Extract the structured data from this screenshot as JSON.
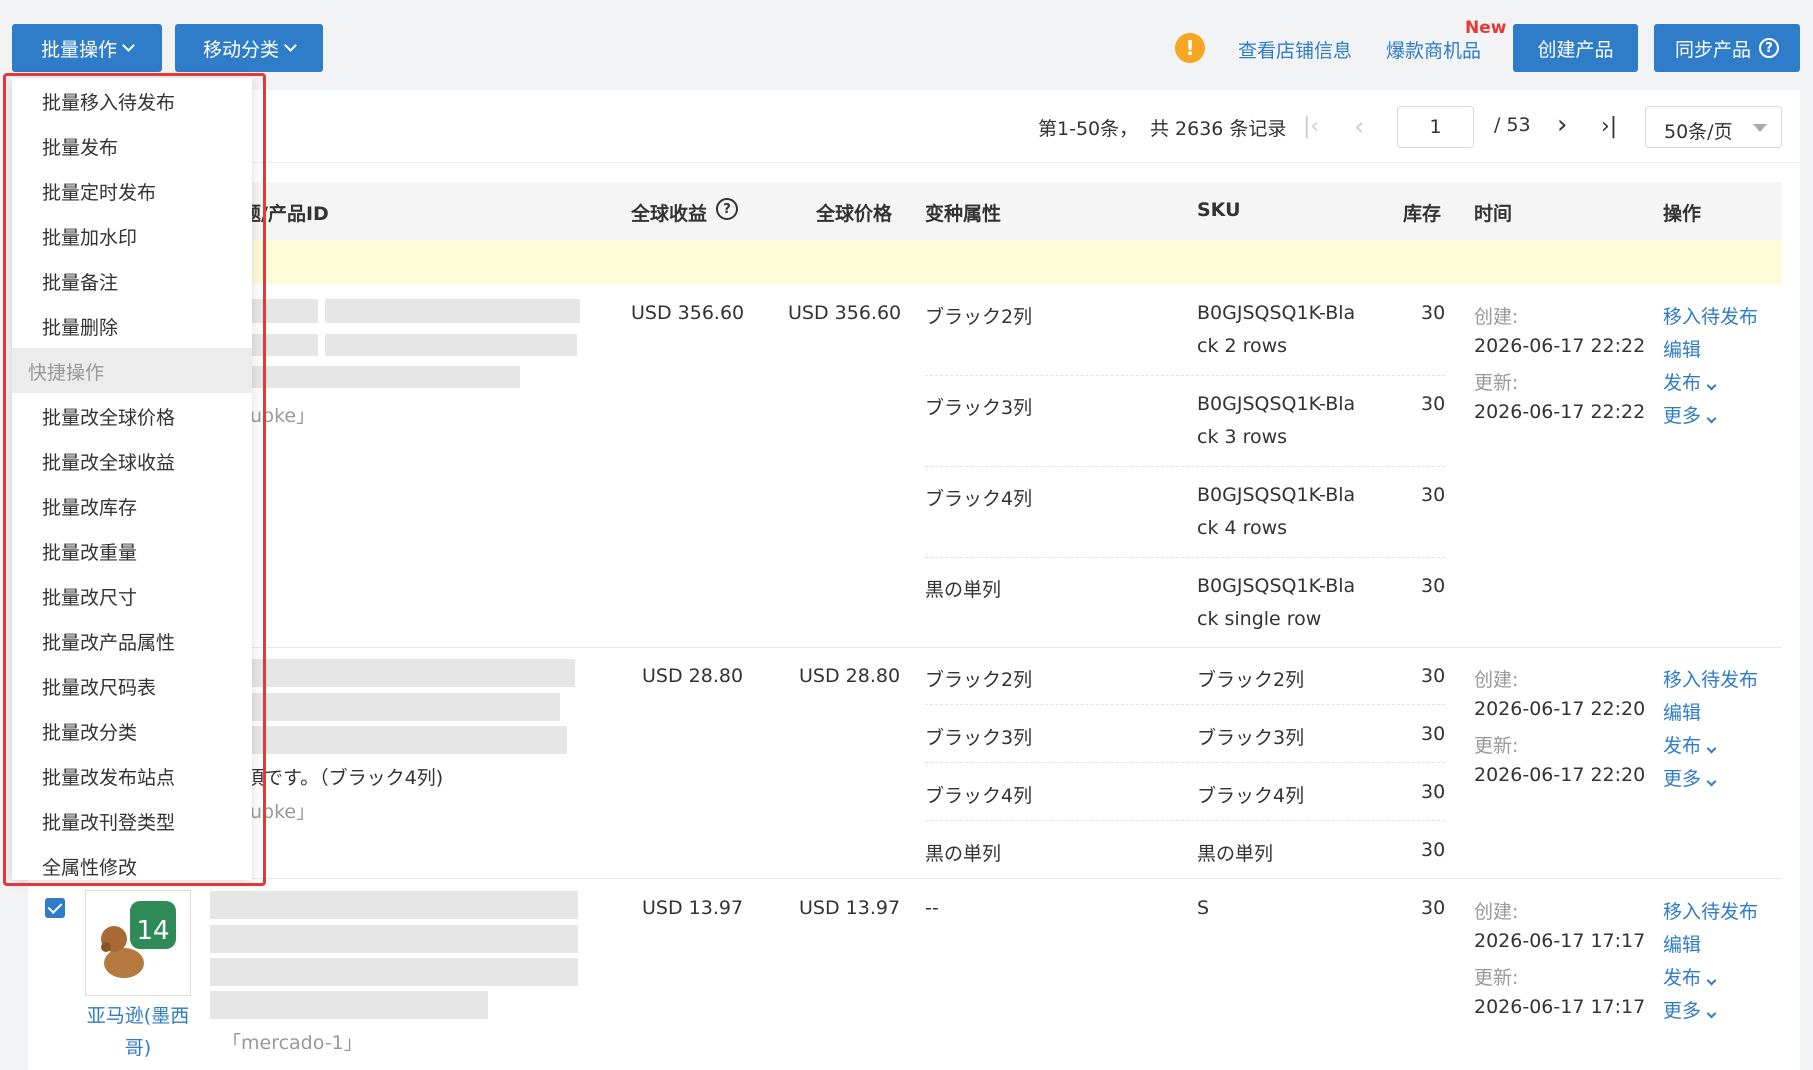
{
  "toolbar": {
    "batch_ops": "批量操作",
    "move_category": "移动分类",
    "store_info": "查看店铺信息",
    "hot_products": "爆款商机品",
    "new_badge": "New",
    "create_product": "创建产品",
    "sync_product": "同步产品"
  },
  "pagination": {
    "range": "第1-50条，",
    "total": "共 2636 条记录",
    "page_input": "1",
    "page_total": "/ 53",
    "per_page": "50条/页"
  },
  "table": {
    "headers": {
      "product": "题/产品ID",
      "global_profit": "全球收益",
      "global_price": "全球价格",
      "variant": "变种属性",
      "sku": "SKU",
      "stock": "库存",
      "time": "时间",
      "ops": "操作"
    },
    "rows": [
      {
        "profit": "USD 356.60",
        "price": "USD 356.60",
        "shop_fragment": "ubke」",
        "created_label": "创建:",
        "created": "2026-06-17 22:22",
        "updated_label": "更新:",
        "updated": "2026-06-17 22:22",
        "variants": [
          {
            "attr": "ブラック2列",
            "sku1": "B0GJSQSQ1K-Bla",
            "sku2": "ck 2 rows",
            "stock": "30"
          },
          {
            "attr": "ブラック3列",
            "sku1": "B0GJSQSQ1K-Bla",
            "sku2": "ck 3 rows",
            "stock": "30"
          },
          {
            "attr": "ブラック4列",
            "sku1": "B0GJSQSQ1K-Bla",
            "sku2": "ck 4 rows",
            "stock": "30"
          },
          {
            "attr": "黒の単列",
            "sku1": "B0GJSQSQ1K-Bla",
            "sku2": "ck single row",
            "stock": "30"
          }
        ]
      },
      {
        "profit": "USD 28.80",
        "price": "USD 28.80",
        "desc_fragment": "頂です。（ブラック4列)",
        "shop_fragment": "ubke」",
        "created_label": "创建:",
        "created": "2026-06-17 22:20",
        "updated_label": "更新:",
        "updated": "2026-06-17 22:20",
        "variants": [
          {
            "attr": "ブラック2列",
            "sku1": "ブラック2列",
            "stock": "30"
          },
          {
            "attr": "ブラック3列",
            "sku1": "ブラック3列",
            "stock": "30"
          },
          {
            "attr": "ブラック4列",
            "sku1": "ブラック4列",
            "stock": "30"
          },
          {
            "attr": "黒の単列",
            "sku1": "黒の単列",
            "stock": "30"
          }
        ]
      },
      {
        "profit": "USD 13.97",
        "price": "USD 13.97",
        "platform": "亚马逊(墨西哥)",
        "shop": "「mercado-1」",
        "created_label": "创建:",
        "created": "2026-06-17 17:17",
        "updated_label": "更新:",
        "updated": "2026-06-17 17:17",
        "variants": [
          {
            "attr": "--",
            "sku1": "S",
            "stock": "30"
          }
        ]
      }
    ],
    "actions": {
      "move_pending": "移入待发布",
      "edit": "编辑",
      "publish": "发布",
      "more": "更多"
    }
  },
  "dropdown": {
    "items": [
      "批量移入待发布",
      "批量发布",
      "批量定时发布",
      "批量加水印",
      "批量备注",
      "批量删除"
    ],
    "section": "快捷操作",
    "quick_items": [
      "批量改全球价格",
      "批量改全球收益",
      "批量改库存",
      "批量改重量",
      "批量改尺寸",
      "批量改产品属性",
      "批量改尺码表",
      "批量改分类",
      "批量改发布站点",
      "批量改刊登类型",
      "全属性修改"
    ]
  },
  "colors": {
    "primary": "#2f7cc9",
    "warning": "#f5a623",
    "new_badge": "#e53935",
    "highlight": "#e53935"
  }
}
